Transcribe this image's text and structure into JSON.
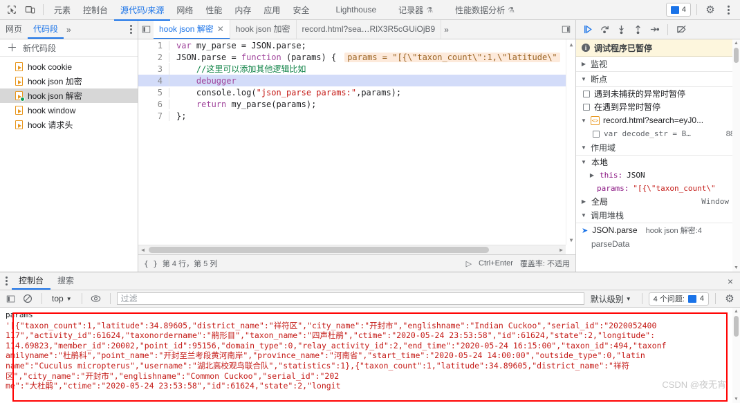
{
  "main_toolbar": {
    "icons": [
      "inspect-icon",
      "device-toolbar-icon"
    ],
    "tabs": [
      {
        "label": "元素",
        "selected": false,
        "flask": false
      },
      {
        "label": "控制台",
        "selected": false,
        "flask": false
      },
      {
        "label": "源代码/来源",
        "selected": true,
        "flask": false
      },
      {
        "label": "网络",
        "selected": false,
        "flask": false
      },
      {
        "label": "性能",
        "selected": false,
        "flask": false
      },
      {
        "label": "内存",
        "selected": false,
        "flask": false
      },
      {
        "label": "应用",
        "selected": false,
        "flask": false
      },
      {
        "label": "安全",
        "selected": false,
        "flask": false
      },
      {
        "label": "Lighthouse",
        "selected": false,
        "flask": false
      },
      {
        "label": "记录器",
        "selected": false,
        "flask": true
      },
      {
        "label": "性能数据分析",
        "selected": false,
        "flask": true
      }
    ],
    "issues_count": "4",
    "settings_title": "设置",
    "more_title": "更多选项"
  },
  "row2": {
    "nav_tabs": [
      {
        "label": "网页",
        "selected": false
      },
      {
        "label": "代码段",
        "selected": true
      }
    ],
    "nav_more": "»",
    "nav_kebab": "更多选项",
    "editor_tabs": [
      {
        "label": "hook json 解密",
        "selected": true,
        "closable": true
      },
      {
        "label": "hook json 加密",
        "selected": false,
        "closable": false
      },
      {
        "label": "record.html?sea…RlX3R5cGUiOjB9",
        "selected": false,
        "closable": false
      }
    ],
    "editor_tabs_more": "»",
    "debug_buttons": [
      "resume-script-execution-icon",
      "step-over-next-function-call-icon",
      "step-into-next-function-call-icon",
      "step-out-of-current-function-icon",
      "step-icon",
      "deactivate-breakpoints-icon"
    ]
  },
  "sidebar": {
    "new_snippet_label": "新代码段",
    "items": [
      {
        "label": "hook cookie",
        "selected": false,
        "running": false
      },
      {
        "label": "hook json 加密",
        "selected": false,
        "running": false
      },
      {
        "label": "hook json 解密",
        "selected": true,
        "running": true
      },
      {
        "label": "hook window",
        "selected": false,
        "running": false
      },
      {
        "label": "hook 请求头",
        "selected": false,
        "running": false
      }
    ]
  },
  "editor": {
    "lines": [
      {
        "n": "1",
        "highlight": false
      },
      {
        "n": "2",
        "highlight": false
      },
      {
        "n": "3",
        "highlight": false
      },
      {
        "n": "4",
        "highlight": true
      },
      {
        "n": "5",
        "highlight": false
      },
      {
        "n": "6",
        "highlight": false
      },
      {
        "n": "7",
        "highlight": false
      }
    ],
    "code": {
      "l1_kw": "var",
      "l1_rest": " my_parse = JSON.parse;",
      "l2_a": "JSON.parse = ",
      "l2_kw": "function",
      "l2_b": " (params) {",
      "l2_hint": "params = \"[{\\\"taxon_count\\\":1,\\\"latitude\\\"",
      "l3_comment": "    //这里可以添加其他逻辑比如",
      "l4_debugger": "    debugger",
      "l5_a": "    console.log(",
      "l5_str": "\"json_parse params:\"",
      "l5_b": ",params);",
      "l6_kw": "    return",
      "l6_rest": " my_parse(params);",
      "l7": "};"
    },
    "status": {
      "braces": "{ }",
      "position": "第 4 行，第 5 列",
      "run_shortcut": "Ctrl+Enter",
      "coverage": "覆盖率: 不适用"
    }
  },
  "debugger_panel": {
    "paused_banner": "调试程序已暂停",
    "watch_title": "监视",
    "breakpoints_title": "断点",
    "pause_uncaught": "遇到未捕获的异常时暂停",
    "pause_caught": "在遇到异常时暂停",
    "bp_file": "record.html?search=eyJ0...",
    "bp_entry": "var decode_str = B…",
    "bp_line": "88",
    "scope_title": "作用域",
    "local_title": "本地",
    "this_name": "this:",
    "this_value": "JSON",
    "params_name": "params:",
    "params_value": "\"[{\\\"taxon_count\\\"",
    "global_title": "全局",
    "global_value": "Window",
    "callstack_title": "调用堆栈",
    "stack": [
      {
        "fn": "JSON.parse",
        "loc": "hook json 解密:4",
        "active": true
      },
      {
        "fn": "parseData",
        "loc": "",
        "active": false
      }
    ]
  },
  "drawer": {
    "tabs": [
      {
        "label": "控制台",
        "selected": true
      },
      {
        "label": "搜索",
        "selected": false
      }
    ],
    "close_label": "×",
    "toolbar": {
      "sidebar_icon": "console-sidebar-icon",
      "clear_icon": "clear-console-icon",
      "context": "top",
      "eye_icon": "live-expression-icon",
      "filter_value": "",
      "filter_placeholder": "过滤",
      "level": "默认级别",
      "issues_label": "4 个问题:",
      "issues_count": "4",
      "settings_icon": "gear-icon"
    },
    "console": {
      "label": "params",
      "lines": [
        "'[{\"taxon_count\":1,\"latitude\":34.89605,\"district_name\":\"祥符区\",\"city_name\":\"开封市\",\"englishname\":\"Indian Cuckoo\",\"serial_id\":\"2020052400",
        "117\",\"activity_id\":61624,\"taxonordername\":\"鹃形目\",\"taxon_name\":\"四声杜鹃\",\"ctime\":\"2020-05-24 23:53:58\",\"id\":61624,\"state\":2,\"longitude\":",
        "114.69823,\"member_id\":20002,\"point_id\":95156,\"domain_type\":0,\"relay_activity_id\":2,\"end_time\":\"2020-05-24 16:15:00\",\"taxon_id\":494,\"taxonf",
        "amilyname\":\"杜鹃科\",\"point_name\":\"开封至兰考段黄河南岸\",\"province_name\":\"河南省\",\"start_time\":\"2020-05-24 14:00:00\",\"outside_type\":0,\"latin",
        "name\":\"Cuculus micropterus\",\"username\":\"湖北高校观鸟联合队\",\"statistics\":1},{\"taxon_count\":1,\"latitude\":34.89605,\"district_name\":\"祥符",
        "区\",\"city_name\":\"开封市\",\"englishname\":\"Common Cuckoo\",\"serial_id\":\"202",
        "me\":\"大杜鹃\",\"ctime\":\"2020-05-24 23:53:58\",\"id\":61624,\"state\":2,\"longit"
      ]
    },
    "watermark": "CSDN @夜无宵"
  },
  "colors": {
    "accent": "#1a73e8",
    "string": "#c41a16",
    "keyword": "#a0459c",
    "comment": "#0b8043",
    "highlight": "#d3dcf9",
    "paused_bg": "#fdf6dd",
    "red_box": "#ff0000"
  }
}
